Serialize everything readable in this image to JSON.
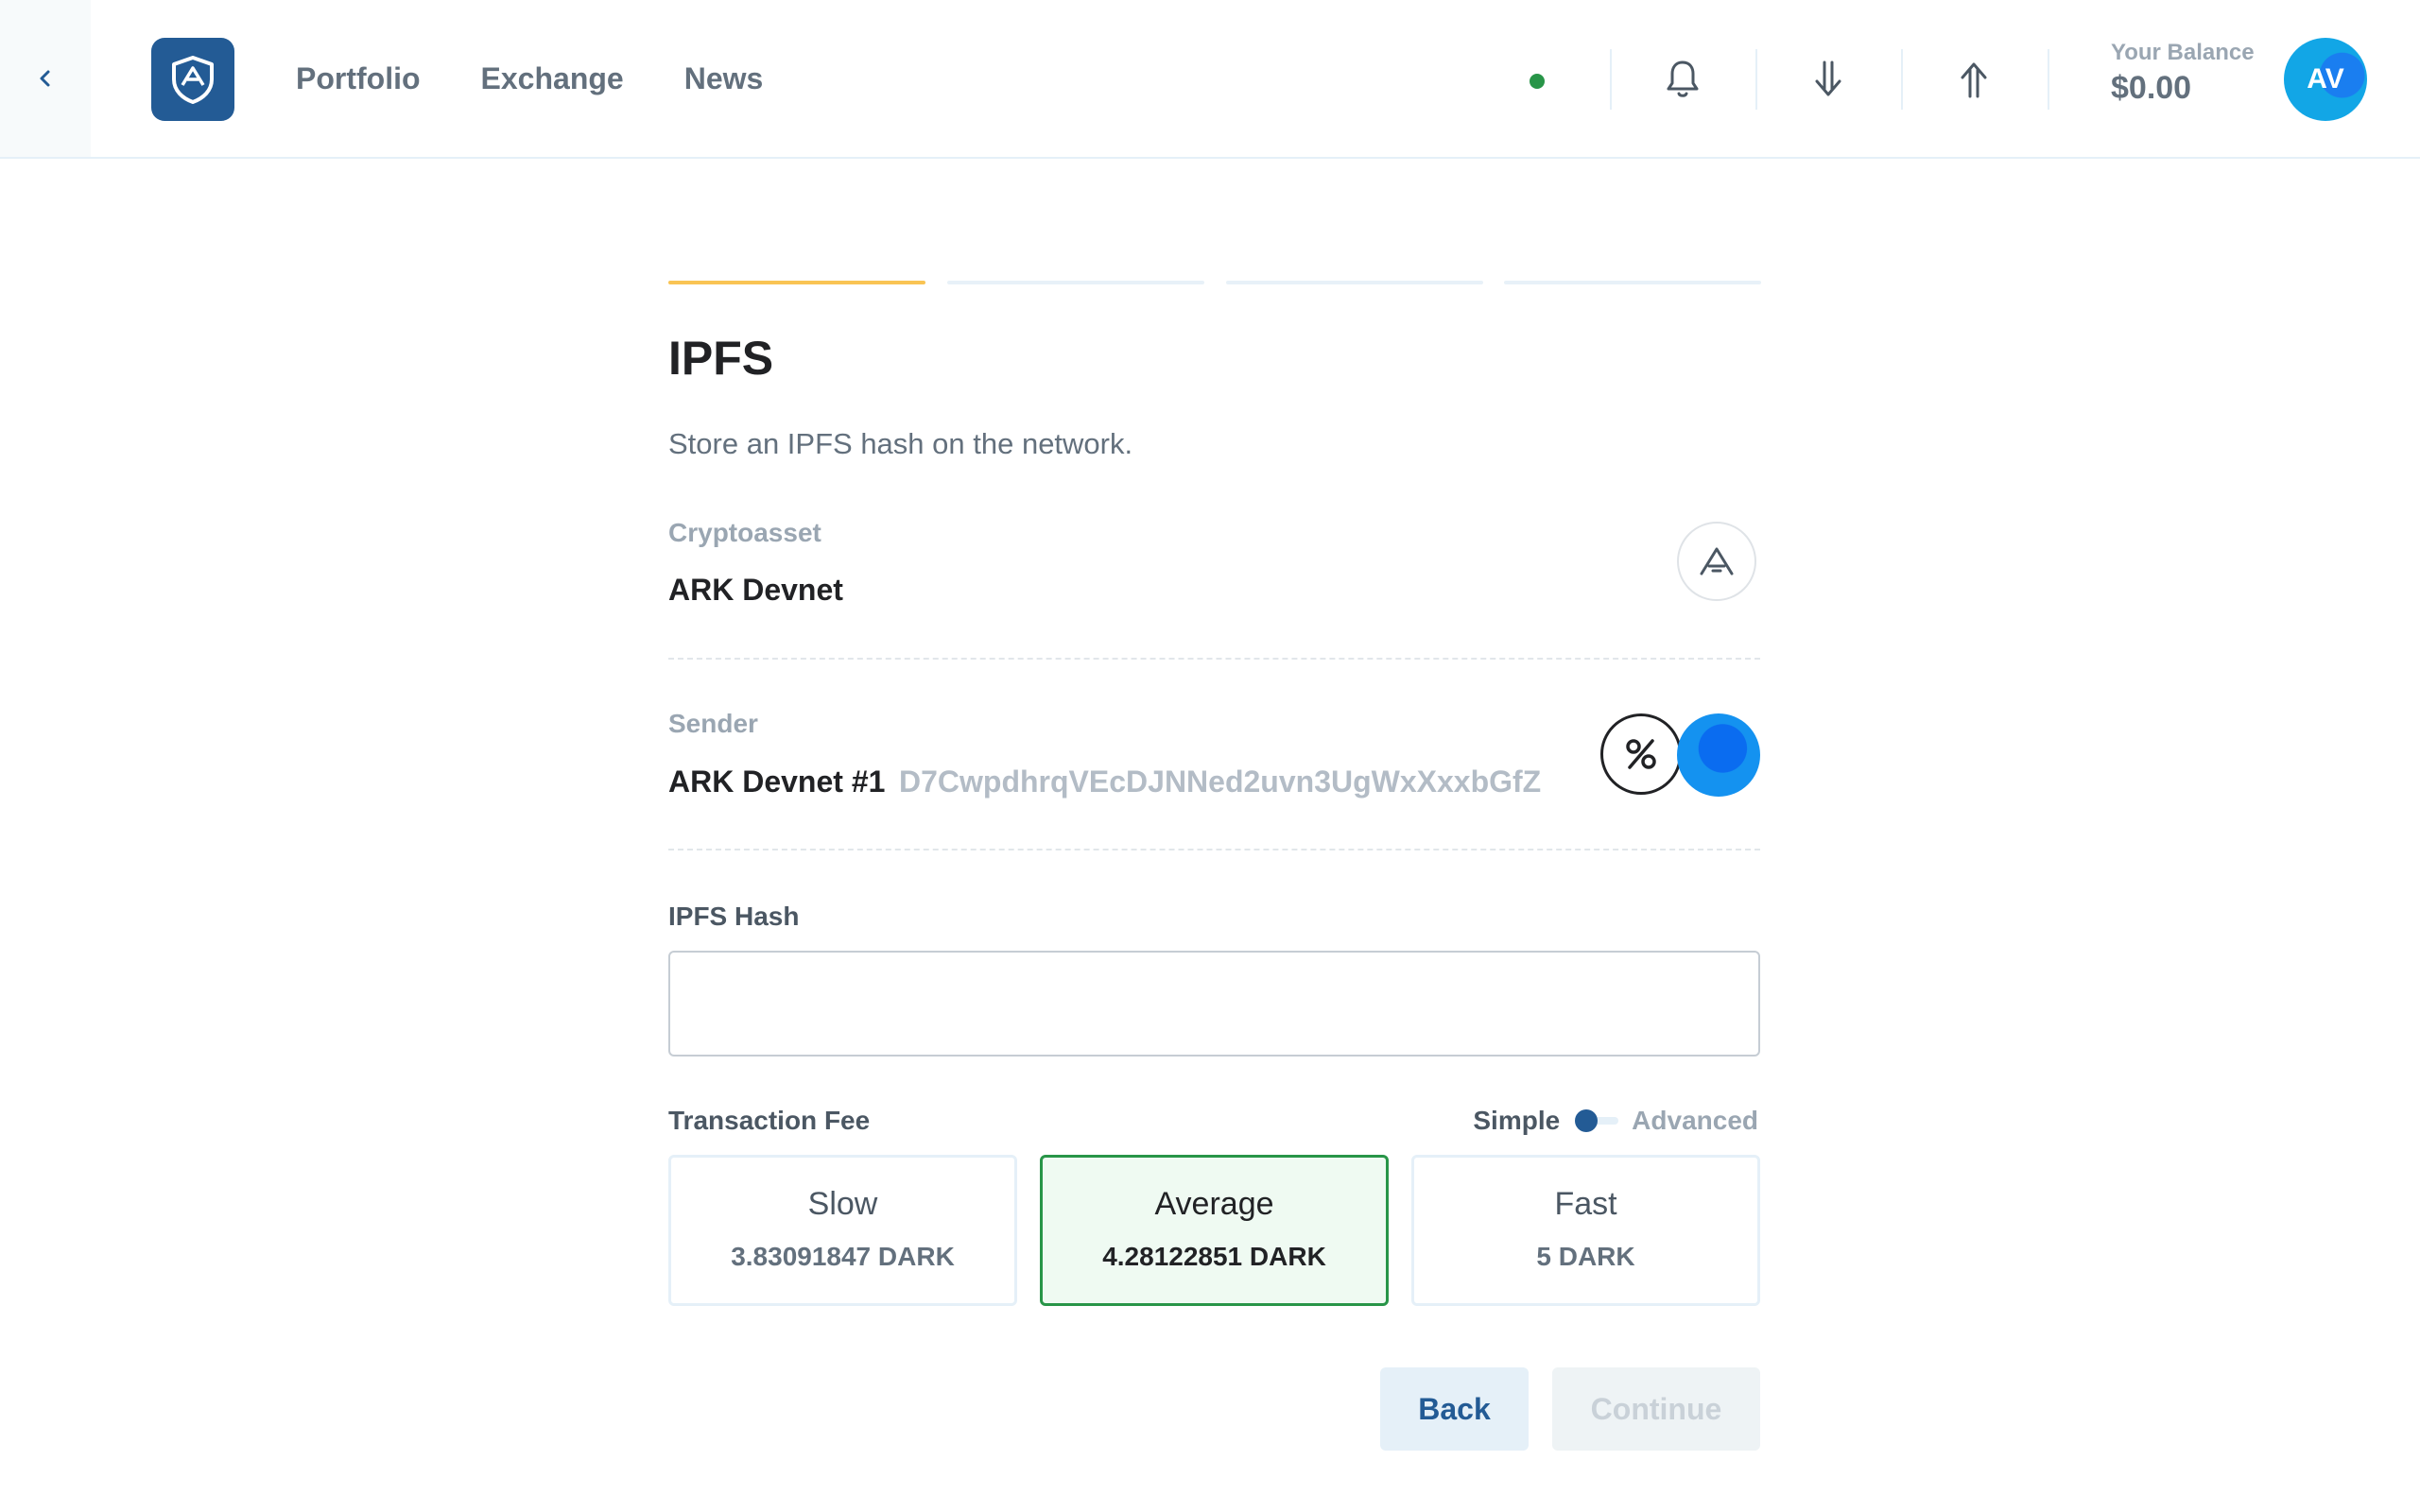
{
  "header": {
    "nav": [
      "Portfolio",
      "Exchange",
      "News"
    ],
    "balance_label": "Your Balance",
    "balance_value": "$0.00",
    "avatar_initials": "AV",
    "status_color": "#289548",
    "icons": [
      "chevron-left-icon",
      "ark-logo-icon",
      "bell-icon",
      "receive-icon",
      "send-icon"
    ]
  },
  "steps": {
    "total": 4,
    "current": 1
  },
  "form": {
    "title": "IPFS",
    "description": "Store an IPFS hash on the network.",
    "cryptoasset_label": "Cryptoasset",
    "cryptoasset_value": "ARK Devnet",
    "sender_label": "Sender",
    "sender_name": "ARK Devnet #1",
    "sender_address": "D7CwpdhrqVEcDJNNed2uvn3UgWxXxxbGfZ",
    "hash_label": "IPFS Hash",
    "hash_value": "",
    "fee_label": "Transaction Fee",
    "fee_mode_simple": "Simple",
    "fee_mode_advanced": "Advanced",
    "fees": [
      {
        "name": "Slow",
        "amount": "3.83091847 DARK"
      },
      {
        "name": "Average",
        "amount": "4.28122851 DARK",
        "selected": true
      },
      {
        "name": "Fast",
        "amount": "5 DARK"
      }
    ],
    "back_label": "Back",
    "continue_label": "Continue"
  },
  "colors": {
    "accent": "#235b95",
    "step_active": "#f9c454",
    "success": "#289548"
  }
}
